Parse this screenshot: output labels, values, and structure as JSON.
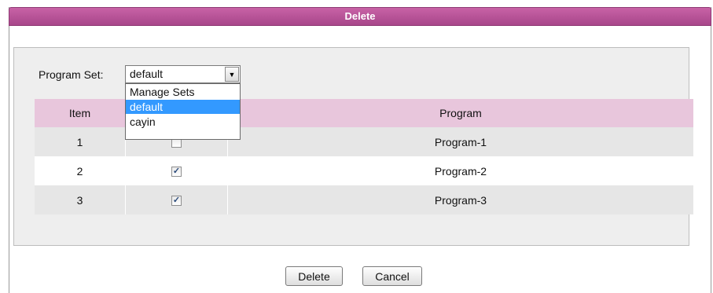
{
  "dialog": {
    "title": "Delete"
  },
  "program_set": {
    "label": "Program Set:",
    "value": "default",
    "options": [
      "Manage Sets",
      "default",
      "cayin"
    ],
    "selected_index": 1
  },
  "table": {
    "headers": {
      "item": "Item",
      "check": "",
      "program": "Program"
    },
    "rows": [
      {
        "item": "1",
        "checked": false,
        "program": "Program-1"
      },
      {
        "item": "2",
        "checked": true,
        "program": "Program-2"
      },
      {
        "item": "3",
        "checked": true,
        "program": "Program-3"
      }
    ]
  },
  "buttons": {
    "delete": "Delete",
    "cancel": "Cancel"
  }
}
